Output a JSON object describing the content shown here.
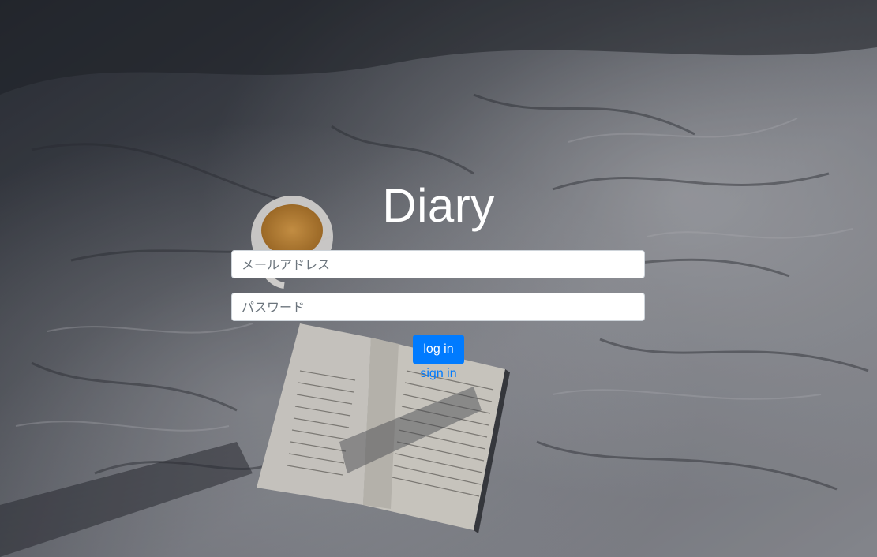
{
  "app": {
    "title": "Diary"
  },
  "form": {
    "email_placeholder": "メールアドレス",
    "email_value": "",
    "password_placeholder": "パスワード",
    "password_value": "",
    "login_label": "log in",
    "signin_label": "sign in"
  },
  "colors": {
    "accent": "#007bff",
    "title": "#ffffff",
    "field_bg": "#ffffff"
  }
}
